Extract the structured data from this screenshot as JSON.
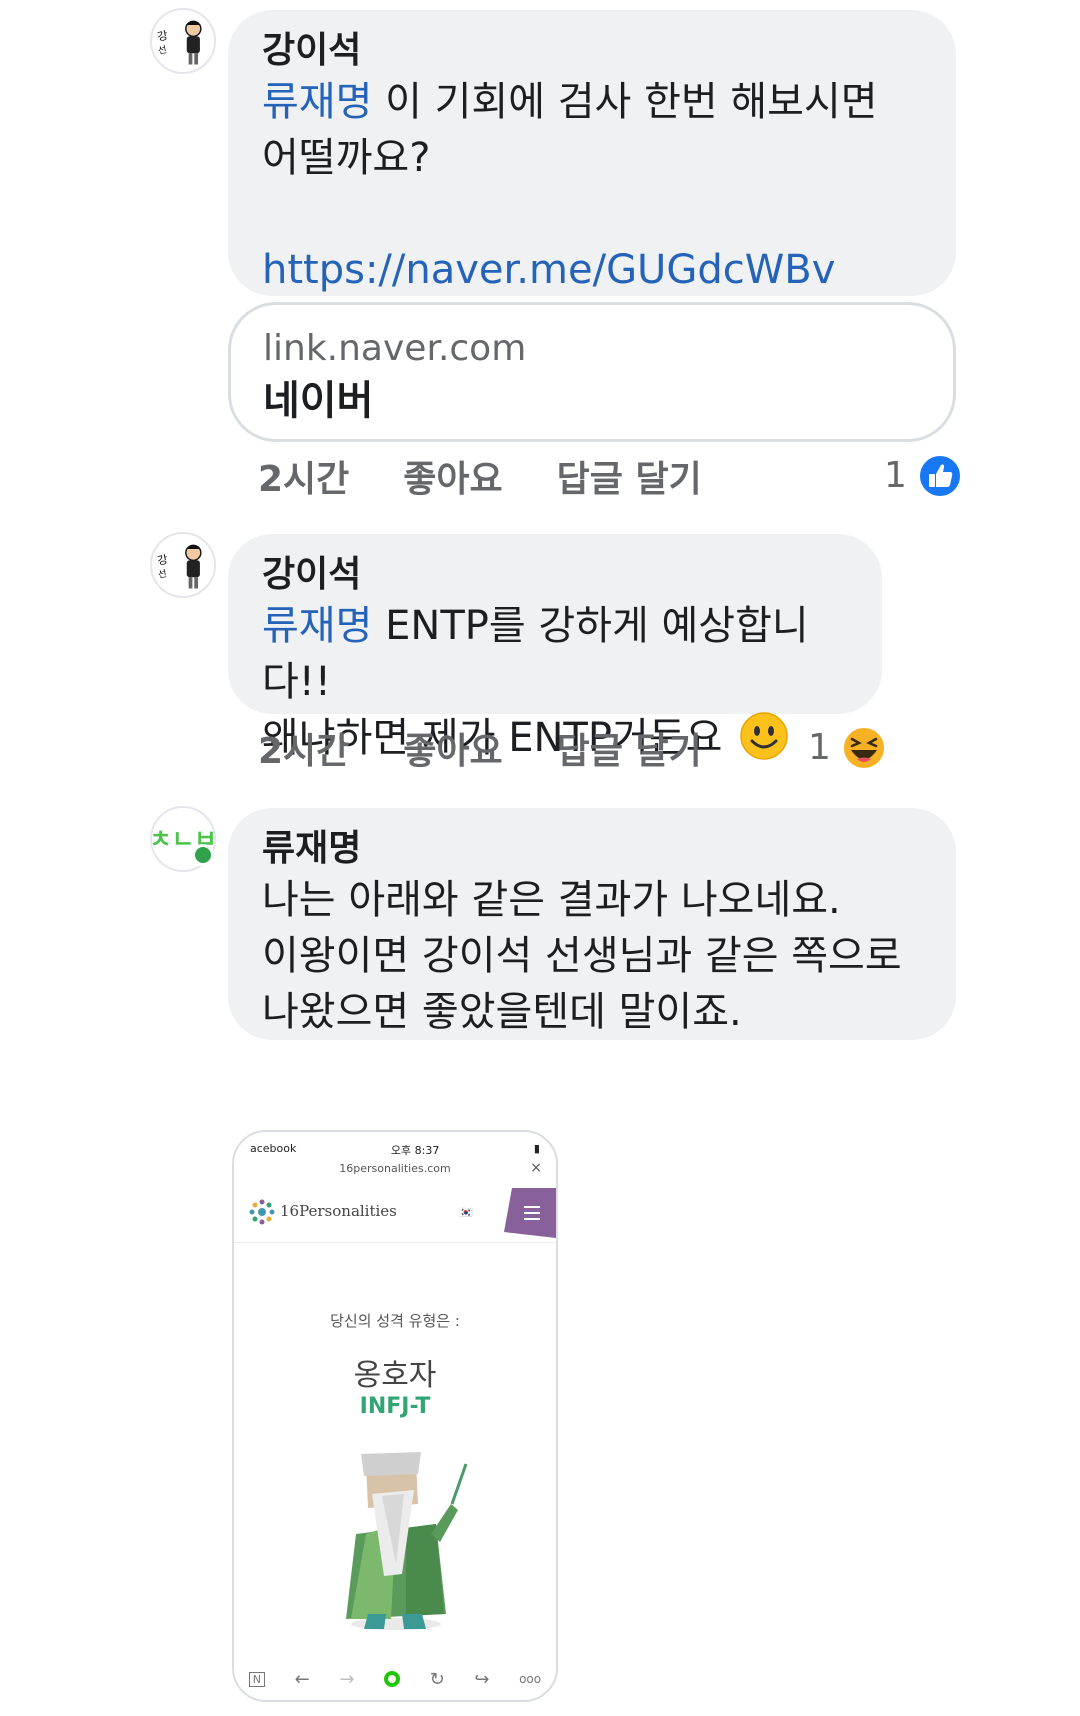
{
  "comments": [
    {
      "author": "강이석",
      "mention": "류재명",
      "text_line1": " 이 기회에 검사 한번 해보시면",
      "text_line2": "어떨까요?",
      "url": "https://naver.me/GUGdcWBv",
      "link_preview": {
        "domain": "link.naver.com",
        "title": "네이버"
      },
      "time": "2시간",
      "like_label": "좋아요",
      "reply_label": "답글 달기",
      "reaction_count": "1",
      "reaction_type": "like-icon"
    },
    {
      "author": "강이석",
      "mention": "류재명",
      "text_line1": " ENTP를 강하게 예상합니다!!",
      "text_line2": "왜냐하면 제가 ENTP거든요",
      "inline_emoji": "smiling-face-icon",
      "time": "2시간",
      "like_label": "좋아요",
      "reply_label": "답글 달기",
      "reaction_count": "1",
      "reaction_type": "laughing-face-icon"
    },
    {
      "author": "류재명",
      "text_line1": "나는 아래와 같은 결과가 나오네요.",
      "text_line2": "이왕이면 강이석 선생님과 같은 쪽으로",
      "text_line3": "나왔으면 좋았을텐데 말이죠.",
      "online": true,
      "attachment": {
        "status_left": "acebook",
        "status_time": "오후 8:37",
        "url": "16personalities.com",
        "close": "×",
        "site_name": "16Personalities",
        "subtitle": "당신의 성격 유형은 :",
        "type_name": "옹호자",
        "type_code": "INFJ-T"
      }
    }
  ],
  "colors": {
    "bubble": "#eff1f3",
    "mention": "#2463b8",
    "meta": "#65676b",
    "like_blue": "#1877f2",
    "online": "#31a24c",
    "infj_green": "#33a474"
  }
}
